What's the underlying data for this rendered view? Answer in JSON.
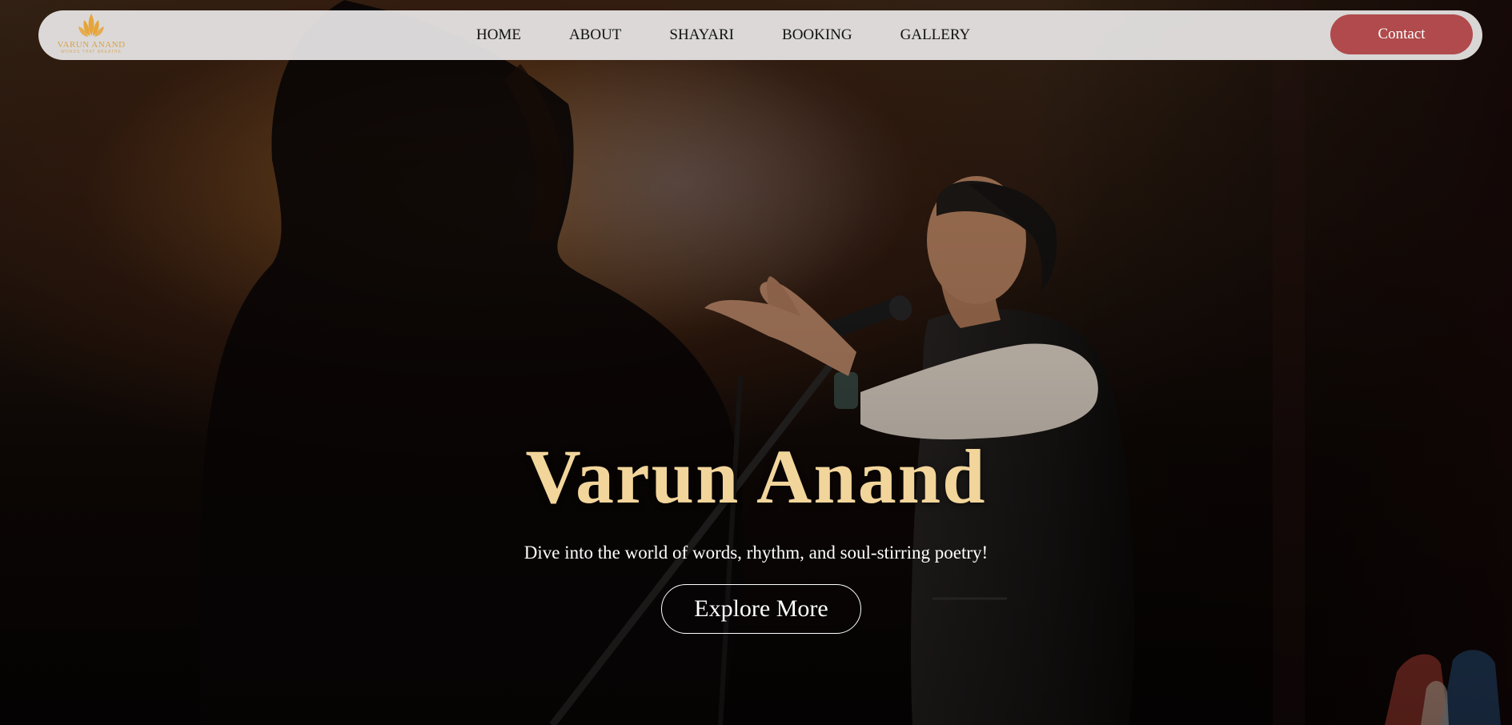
{
  "brand": {
    "logo_name": "VARUN ANAND",
    "logo_tag": "WORDS THAT BREATHE",
    "accent_color": "#d8a24a"
  },
  "nav": {
    "items": [
      {
        "label": "HOME"
      },
      {
        "label": "ABOUT"
      },
      {
        "label": "SHAYARI"
      },
      {
        "label": "BOOKING"
      },
      {
        "label": "GALLERY"
      }
    ],
    "contact_label": "Contact",
    "contact_color": "#b04a4c"
  },
  "hero": {
    "title": "Varun Anand",
    "title_color": "#f2d59b",
    "subtitle": "Dive into the world of words, rhythm, and soul-stirring poetry!",
    "cta_label": "Explore More",
    "background_icon": "poet-performing-on-stage-photo"
  }
}
